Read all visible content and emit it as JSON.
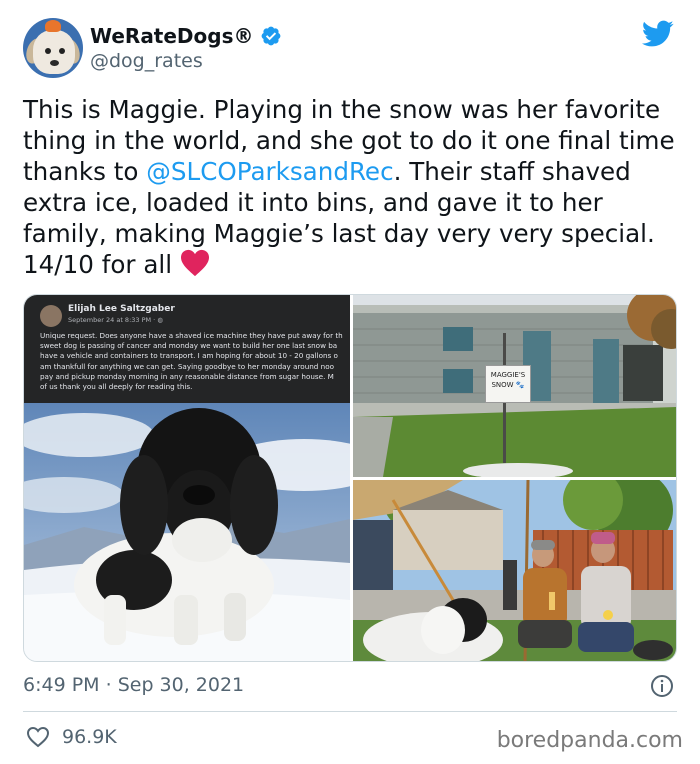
{
  "author": {
    "display_name": "WeRateDogs®",
    "handle": "@dog_rates"
  },
  "tweet": {
    "text_part1": "This is Maggie. Playing in the snow was her favorite thing in the world, and she got to do it one final time thanks to ",
    "mention": "@SLCOParksandRec",
    "text_part2": ". Their staff shaved extra ice, loaded it into bins, and gave it to her family, making Maggie’s last day very very special. 14/10 for all ",
    "emoji": "red-heart"
  },
  "media": {
    "fb_post": {
      "name": "Elijah Lee Saltzgaber",
      "date": "September 24 at 8:33 PM · ",
      "lines": [
        "Unique request. Does anyone have a shaved ice machine they have put away for th",
        "sweet dog is passing of cancer and monday we want to build her one last snow ba",
        "have a vehicle and containers to transport. I am hoping for about 10 - 20 gallons o",
        "am thankfull for anything we can get. Saying goodbye to her monday around noo",
        "pay and pickup monday morning in any reasonable distance from sugar house. M",
        "of us thank you all deeply for reading this."
      ]
    },
    "sign": {
      "line1": "MAGGIE'S",
      "line2": "SNOW"
    }
  },
  "meta": {
    "time": "6:49 PM",
    "separator": " · ",
    "date": "Sep 30, 2021"
  },
  "actions": {
    "like_count": "96.9K"
  },
  "watermark": "boredpanda.com",
  "colors": {
    "accent": "#1d9bf0",
    "heart": "#e0245e",
    "text": "#0f1419",
    "muted": "#536471"
  }
}
